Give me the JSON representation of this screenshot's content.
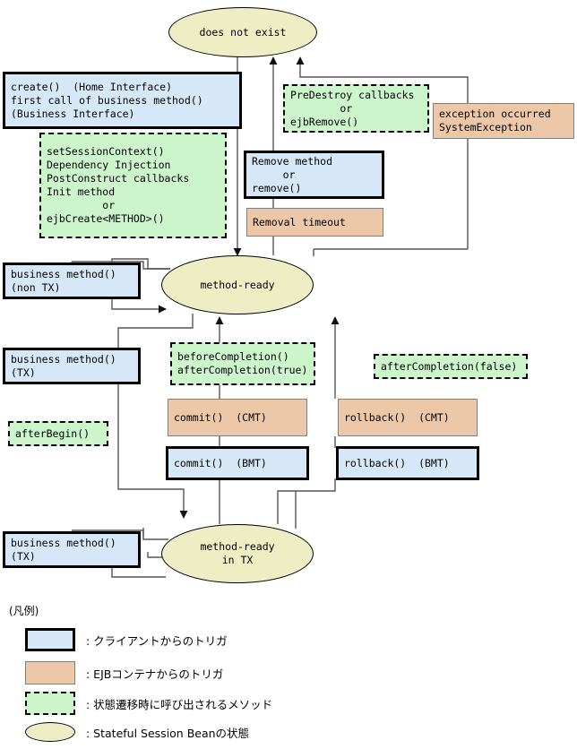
{
  "diagram": {
    "title": "Stateful Session Bean lifecycle state diagram",
    "colors": {
      "client_trigger_fill": "#d6e8f7",
      "container_trigger_fill": "#edc8a8",
      "callback_fill": "#ccf5cc",
      "state_fill": "#eeeec4",
      "border": "#000000",
      "thin_border": "#808080"
    },
    "states": {
      "does_not_exist": "does not exist",
      "method_ready": "method-ready",
      "method_ready_in_tx_line1": "method-ready",
      "method_ready_in_tx_line2": "in TX"
    },
    "nodes": {
      "create_box": "create()  (Home Interface)\nfirst call of business method()\n(Business Interface)",
      "create_callbacks": "setSessionContext()\nDependency Injection\nPostConstruct callbacks\nInit method\n         or\nejbCreate<METHOD>()",
      "predestroy_callbacks": "PreDestroy callbacks\n        or\nejbRemove()",
      "exception_occurred": "exception occurred\nSystemException",
      "remove_method": "Remove method\n     or\nremove()",
      "removal_timeout": "Removal timeout",
      "business_method_nontx": "business method()\n(non TX)",
      "business_method_tx_upper": "business method()\n(TX)",
      "business_method_tx_lower": "business method()\n(TX)",
      "after_begin": "afterBegin()",
      "before_after_completion_true": "beforeCompletion()\nafterCompletion(true)",
      "after_completion_false": "afterCompletion(false)",
      "commit_cmt": "commit()  (CMT)",
      "commit_bmt": "commit()  (BMT)",
      "rollback_cmt": "rollback()  (CMT)",
      "rollback_bmt": "rollback()  (BMT)"
    },
    "legend": {
      "title": "(凡例)",
      "items": [
        {
          "swatch": "client",
          "label": ": クライアントからのトリガ"
        },
        {
          "swatch": "container",
          "label": ": EJBコンテナからのトリガ"
        },
        {
          "swatch": "callback",
          "label": ": 状態遷移時に呼び出されるメソッド"
        },
        {
          "swatch": "state",
          "label": ": Stateful Session Beanの状態"
        }
      ]
    }
  }
}
